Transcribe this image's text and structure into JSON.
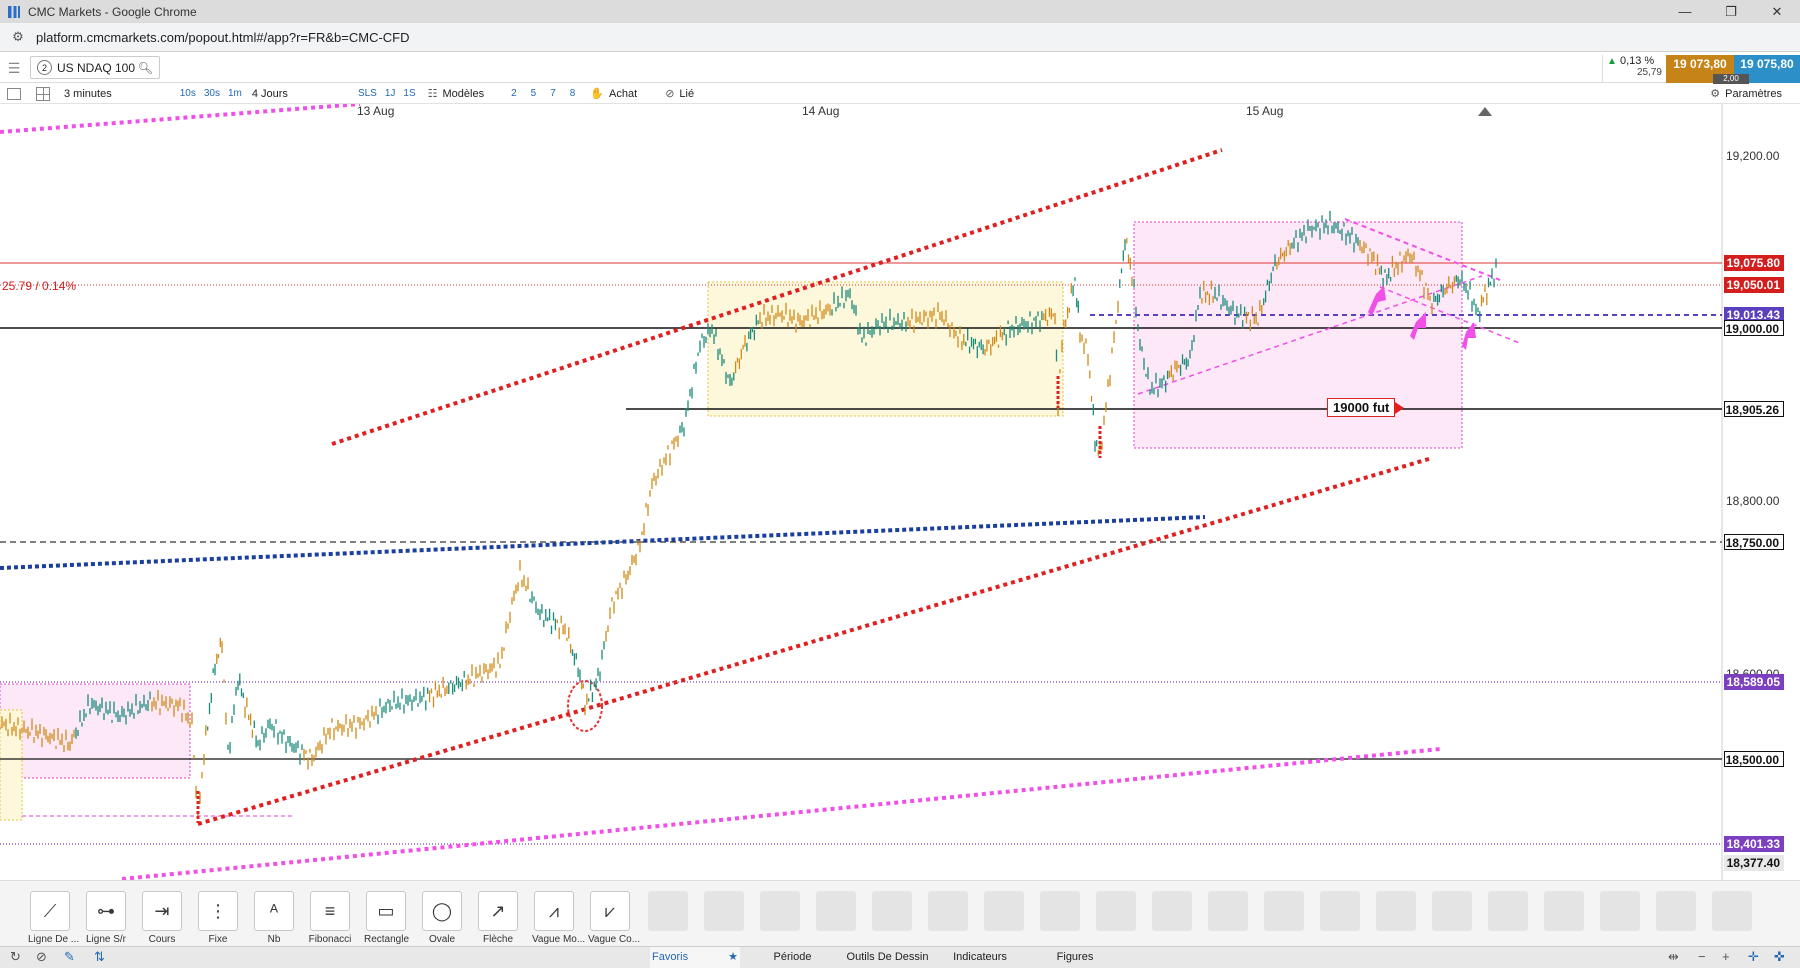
{
  "window": {
    "title": "CMC Markets - Google Chrome",
    "url": "platform.cmcmarkets.com/popout.html#/app?r=FR&b=CMC-CFD"
  },
  "instrument": {
    "index": "2",
    "name": "US NDAQ 100",
    "change_pct": "0,13 %",
    "change_pts": "25,79",
    "sell": "19 073,80",
    "buy": "19 075,80",
    "spread": "2,00",
    "settings_label": "Paramètres"
  },
  "toolbar": {
    "timeframe": "3 minutes",
    "intervals": [
      "10s",
      "30s",
      "1m"
    ],
    "period": "4 Jours",
    "sls": "SLS",
    "periods2": [
      "1J",
      "1S"
    ],
    "models_label": "Modèles",
    "numbers": [
      "2",
      "5",
      "7",
      "8"
    ],
    "buy_label": "Achat",
    "link_label": "Lié"
  },
  "chart": {
    "dates": [
      "13 Aug",
      "14 Aug",
      "15 Aug"
    ],
    "change_label": "25.79 / 0.14%",
    "fut_label": "19000 fut",
    "price_ticks": [
      "19,200.00",
      "18,800.00",
      "18,600.00"
    ],
    "labels": {
      "l19075": "19,075.80",
      "l19050": "19,050.01",
      "l19013": "19,013.43",
      "l19000": "19,000.00",
      "l18905": "18,905.26",
      "l18750": "18,750.00",
      "l18589": "18,589.05",
      "l18500": "18,500.00",
      "l18401": "18,401.33",
      "l18377": "18,377.40"
    },
    "colors": {
      "up": "#1a8a7a",
      "down": "#d18a18",
      "trend_red": "#e02020",
      "trend_pink": "#f050e8",
      "trend_blue": "#1a3fa0"
    }
  },
  "drawtools": [
    {
      "label": "Ligne De ...",
      "icon": "line-icon"
    },
    {
      "label": "Ligne S/r",
      "icon": "sr-line-icon"
    },
    {
      "label": "Cours",
      "icon": "price-icon"
    },
    {
      "label": "Fixe",
      "icon": "fixed-icon"
    },
    {
      "label": "Nb",
      "icon": "text-icon"
    },
    {
      "label": "Fibonacci",
      "icon": "fibonacci-icon"
    },
    {
      "label": "Rectangle",
      "icon": "rectangle-icon"
    },
    {
      "label": "Ovale",
      "icon": "oval-icon"
    },
    {
      "label": "Flèche",
      "icon": "arrow-icon"
    },
    {
      "label": "Vague Mo...",
      "icon": "wave-icon"
    },
    {
      "label": "Vague Co...",
      "icon": "corrective-wave-icon"
    }
  ],
  "tabs": {
    "favoris": "Favoris",
    "periode": "Période",
    "outils": "Outils De Dessin",
    "indicateurs": "Indicateurs",
    "figures": "Figures"
  }
}
